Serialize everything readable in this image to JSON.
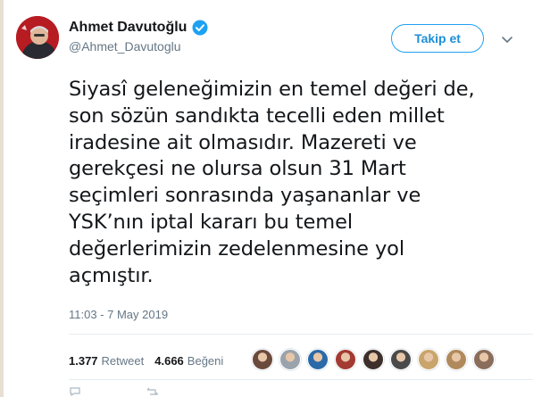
{
  "tweet": {
    "author": {
      "display_name": "Ahmet Davutoğlu",
      "handle": "@Ahmet_Davutoglu",
      "verified": true
    },
    "follow_label": "Takip et",
    "text": "Siyasî geleneğimizin en temel değeri de,\nson sözün sandıkta tecelli eden millet\niradesine ait olmasıdır. Mazereti ve\ngerekçesi ne olursa olsun 31 Mart\nseçimleri sonrasında yaşananlar ve\nYSK’nın iptal kararı bu temel\ndeğerlerimizin zedelenmesine yol\naçmıştır.",
    "timestamp": "11:03 - 7 May 2019",
    "stats": {
      "retweets": {
        "count": "1.377",
        "label": "Retweet"
      },
      "likes": {
        "count": "4.666",
        "label": "Beğeni"
      }
    },
    "liker_avatar_colors": [
      "#6b4a3e",
      "#9aa3ab",
      "#2b6aa8",
      "#a33b32",
      "#3c2f2c",
      "#4a4a4a",
      "#c9a46b",
      "#b08a5c",
      "#8a6d5a"
    ]
  },
  "colors": {
    "accent": "#1da1f2",
    "text": "#14171a",
    "muted": "#657786"
  }
}
